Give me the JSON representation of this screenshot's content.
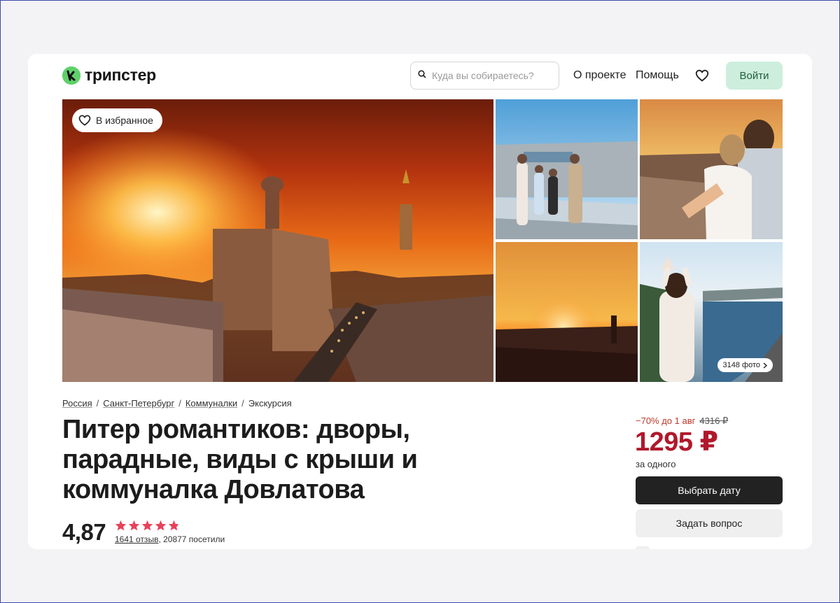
{
  "header": {
    "logo_text": "трипстер",
    "search_placeholder": "Куда вы собираетесь?",
    "nav_about": "О проекте",
    "nav_help": "Помощь",
    "login_label": "Войти"
  },
  "gallery": {
    "favorite_label": "В избранное",
    "photos_count": "3148 фото"
  },
  "breadcrumb": [
    "Россия",
    "Санкт-Петербург",
    "Коммуналки",
    "Экскурсия"
  ],
  "tour": {
    "title": "Питер романтиков: дворы, парадные, виды с крыши и коммуналка Довлатова",
    "rating": "4,87",
    "stars": 4.87,
    "reviews_link": "1641 отзыв",
    "visited": ", 20877 посетили"
  },
  "price": {
    "discount": "−70% до 1 авг",
    "old_price": "4316 ₽",
    "current": "1295 ₽",
    "per": "за одного",
    "choose_date_label": "Выбрать дату",
    "ask_label": "Задать вопрос"
  },
  "colors": {
    "brand_green": "#5fd16a",
    "login_bg": "#cdeedd",
    "price_red": "#b0182b",
    "star": "#e8415a"
  }
}
